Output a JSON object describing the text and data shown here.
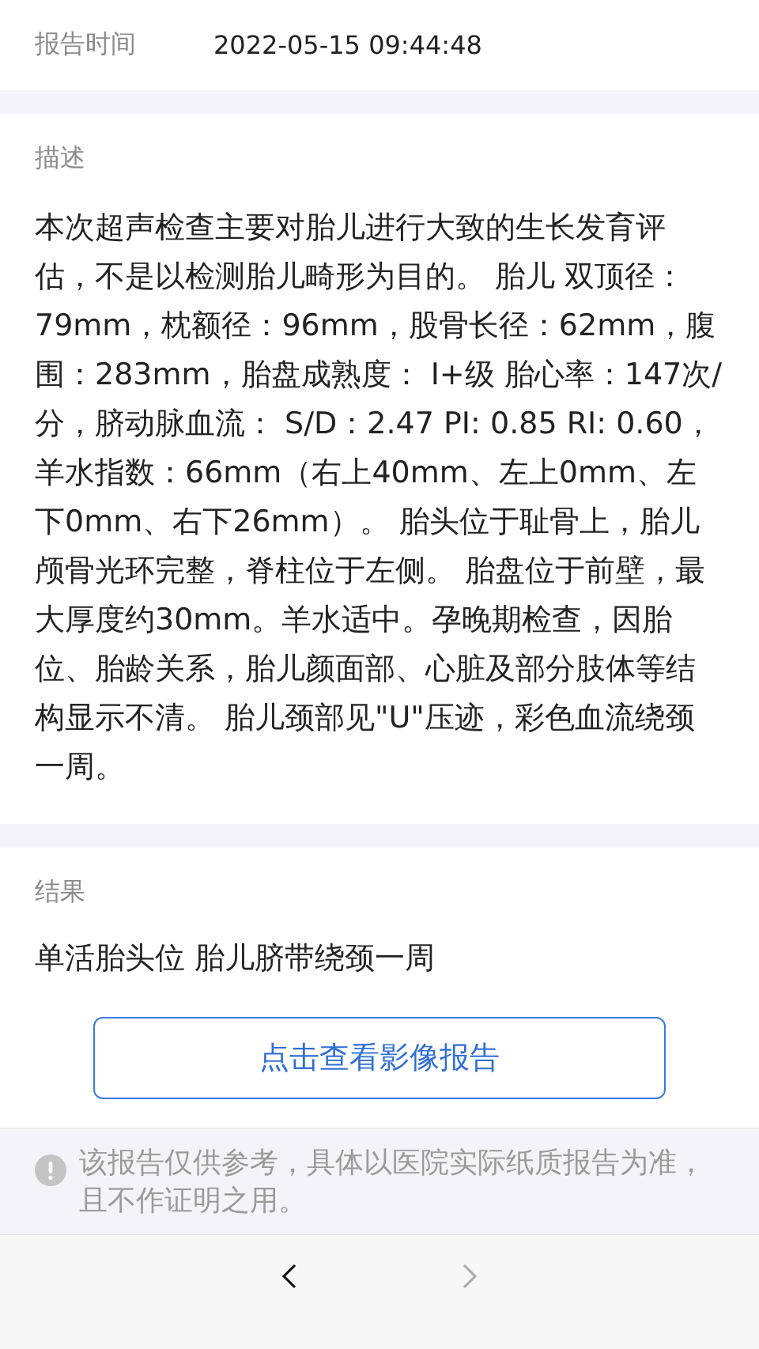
{
  "report_time": {
    "label": "报告时间",
    "value": "2022-05-15 09:44:48"
  },
  "description": {
    "label": "描述",
    "text": "本次超声检查主要对胎儿进行大致的生长发育评估，不是以检测胎儿畸形为目的。 胎儿 双顶径：79mm，枕额径：96mm，股骨长径：62mm，腹围：283mm，胎盘成熟度： Ⅰ+级 胎心率：147次/分，脐动脉血流： S/D：2.47 PI: 0.85 RI: 0.60，羊水指数：66mm（右上40mm、左上0mm、左下0mm、右下26mm）。 胎头位于耻骨上，胎儿颅骨光环完整，脊柱位于左侧。 胎盘位于前壁，最大厚度约30mm。羊水适中。孕晚期检查，因胎位、胎龄关系，胎儿颜面部、心脏及部分肢体等结构显示不清。 胎儿颈部见\"U\"压迹，彩色血流绕颈一周。"
  },
  "result": {
    "label": "结果",
    "text": "单活胎头位 胎儿脐带绕颈一周"
  },
  "image_report_button": "点击查看影像报告",
  "disclaimer": "该报告仅供参考，具体以医院实际纸质报告为准，且不作证明之用。",
  "nav": [
    {
      "kind": "back",
      "disabled": false
    },
    {
      "kind": "forward",
      "disabled": true
    }
  ]
}
